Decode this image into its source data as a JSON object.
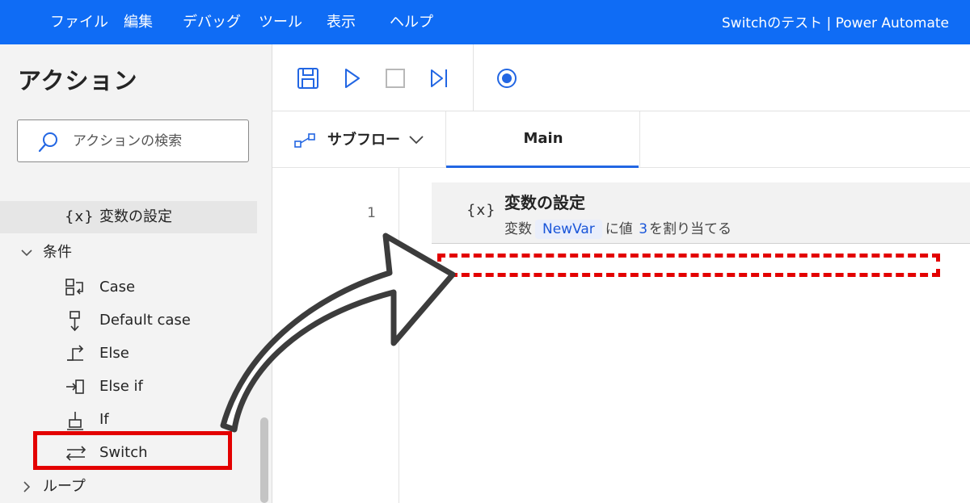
{
  "menubar": {
    "items": [
      "ファイル",
      "編集",
      "デバッグ",
      "ツール",
      "表示",
      "ヘルプ"
    ],
    "window_title": "Switchのテスト | Power Automate"
  },
  "actions_pane": {
    "title": "アクション",
    "search_placeholder": "アクションの検索",
    "items": {
      "set_variable": "変数の設定",
      "conditions_group": "条件",
      "case": "Case",
      "default_case": "Default case",
      "else": "Else",
      "else_if": "Else if",
      "if": "If",
      "switch": "Switch",
      "loops_group": "ループ"
    },
    "icons": {
      "set_variable": "{x}"
    }
  },
  "toolbar": {
    "buttons": [
      "save-icon",
      "run-icon",
      "stop-icon",
      "run-next-icon",
      "record-icon"
    ]
  },
  "tabs": {
    "subflows_label": "サブフロー",
    "main_label": "Main"
  },
  "flow": {
    "steps": [
      {
        "line_number": "1",
        "icon": "{x}",
        "title": "変数の設定",
        "desc_prefix": "変数",
        "variable": "NewVar",
        "desc_middle": "に値",
        "value": "3",
        "desc_suffix": "を割り当てる"
      }
    ]
  },
  "colors": {
    "menubar_bg": "#0f6cf5",
    "accent_blue": "#2266e3",
    "annotation_red": "#e30000",
    "arrow_gray": "#3c3c3c"
  }
}
